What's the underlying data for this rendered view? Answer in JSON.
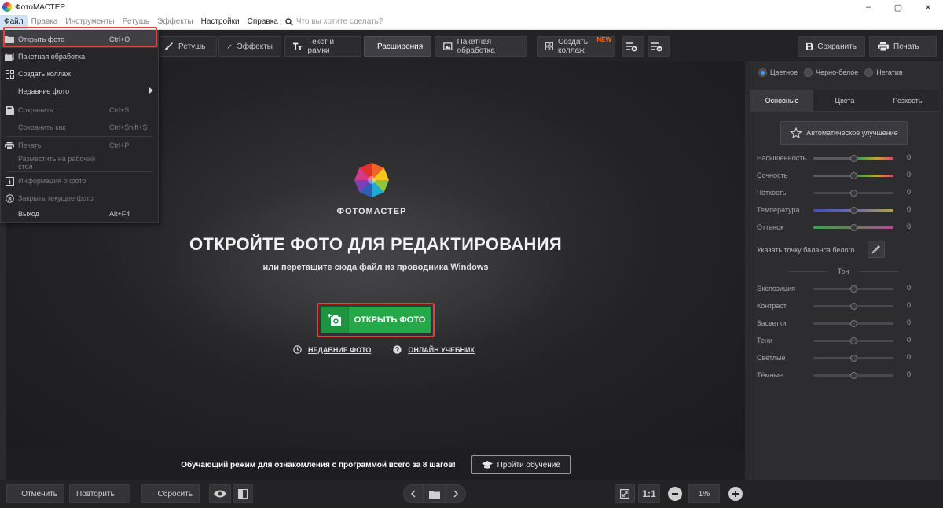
{
  "window": {
    "title": "ФотоМАСТЕР",
    "minimize": "–",
    "restore": "▢",
    "close": "✕"
  },
  "menubar": {
    "items": [
      "Файл",
      "Правка",
      "Инструменты",
      "Ретушь",
      "Эффекты",
      "Настройки",
      "Справка"
    ],
    "search_placeholder": "Что вы хотите сделать?"
  },
  "toolbar": {
    "retouch": "Ретушь",
    "effects": "Эффекты",
    "text_frames": "Текст и рамки",
    "extensions": "Расширения",
    "batch": "Пакетная обработка",
    "collage": "Создать коллаж",
    "collage_badge": "NEW",
    "save": "Сохранить",
    "print": "Печать"
  },
  "file_menu": {
    "items": [
      {
        "label": "Открыть фото",
        "shortcut": "Ctrl+O",
        "icon": "folder-icon",
        "state": "highlighted"
      },
      {
        "label": "Пакетная обработка",
        "shortcut": "",
        "icon": "batch-icon",
        "state": "enabled"
      },
      {
        "label": "Создать коллаж",
        "shortcut": "",
        "icon": "collage-icon",
        "state": "enabled"
      },
      {
        "label": "Недавние фото",
        "shortcut": "",
        "icon": "",
        "state": "submenu"
      },
      {
        "label": "Сохранить...",
        "shortcut": "Ctrl+S",
        "icon": "save-icon",
        "state": "disabled"
      },
      {
        "label": "Сохранить как",
        "shortcut": "Ctrl+Shift+S",
        "icon": "",
        "state": "disabled"
      },
      {
        "label": "Печать",
        "shortcut": "Ctrl+P",
        "icon": "print-icon",
        "state": "disabled"
      },
      {
        "label": "Разместить на рабочий стол",
        "shortcut": "",
        "icon": "",
        "state": "disabled"
      },
      {
        "label": "Информация о фото",
        "shortcut": "",
        "icon": "info-icon",
        "state": "disabled"
      },
      {
        "label": "Закрыть текущее фото",
        "shortcut": "",
        "icon": "close-circle-icon",
        "state": "disabled"
      },
      {
        "label": "Выход",
        "shortcut": "Alt+F4",
        "icon": "",
        "state": "enabled"
      }
    ]
  },
  "canvas": {
    "brand": "ФОТОМАСТЕР",
    "headline": "ОТКРОЙТЕ ФОТО ДЛЯ РЕДАКТИРОВАНИЯ",
    "subline": "или перетащите сюда файл из проводника Windows",
    "open_button": "ОТКРЫТЬ ФОТО",
    "recent_link": "НЕДАВНИЕ ФОТО",
    "tutorial_link": "ОНЛАЙН УЧЕБНИК"
  },
  "tutorial": {
    "text": "Обучающий режим для ознакомления с программой всего за 8 шагов!",
    "button": "Пройти обучение"
  },
  "bottombar": {
    "undo": "Отменить",
    "redo": "Повторить",
    "reset": "Сбросить",
    "ratio": "1:1",
    "zoom": "1%"
  },
  "panel": {
    "modes": [
      {
        "label": "Цветное",
        "selected": true
      },
      {
        "label": "Черно-белое",
        "selected": false
      },
      {
        "label": "Негатив",
        "selected": false
      }
    ],
    "tabs": [
      "Основные",
      "Цвета",
      "Резкость"
    ],
    "auto_button": "Автоматическое улучшение",
    "color_sliders": [
      {
        "label": "Насыщенность",
        "value": "0"
      },
      {
        "label": "Сочность",
        "value": "0"
      },
      {
        "label": "Чёткость",
        "value": "0"
      },
      {
        "label": "Температура",
        "value": "0"
      },
      {
        "label": "Оттенок",
        "value": "0"
      }
    ],
    "white_balance": "Указать точку баланса белого",
    "tone_title": "Тон",
    "tone_sliders": [
      {
        "label": "Экспозиция",
        "value": "0"
      },
      {
        "label": "Контраст",
        "value": "0"
      },
      {
        "label": "Засветки",
        "value": "0"
      },
      {
        "label": "Тени",
        "value": "0"
      },
      {
        "label": "Светлые",
        "value": "0"
      },
      {
        "label": "Тёмные",
        "value": "0"
      }
    ]
  },
  "colors": {
    "accent_green": "#24a848",
    "highlight_red": "#e0433a",
    "radio_blue": "#3ea0f0",
    "badge_orange": "#ff6a1a"
  }
}
